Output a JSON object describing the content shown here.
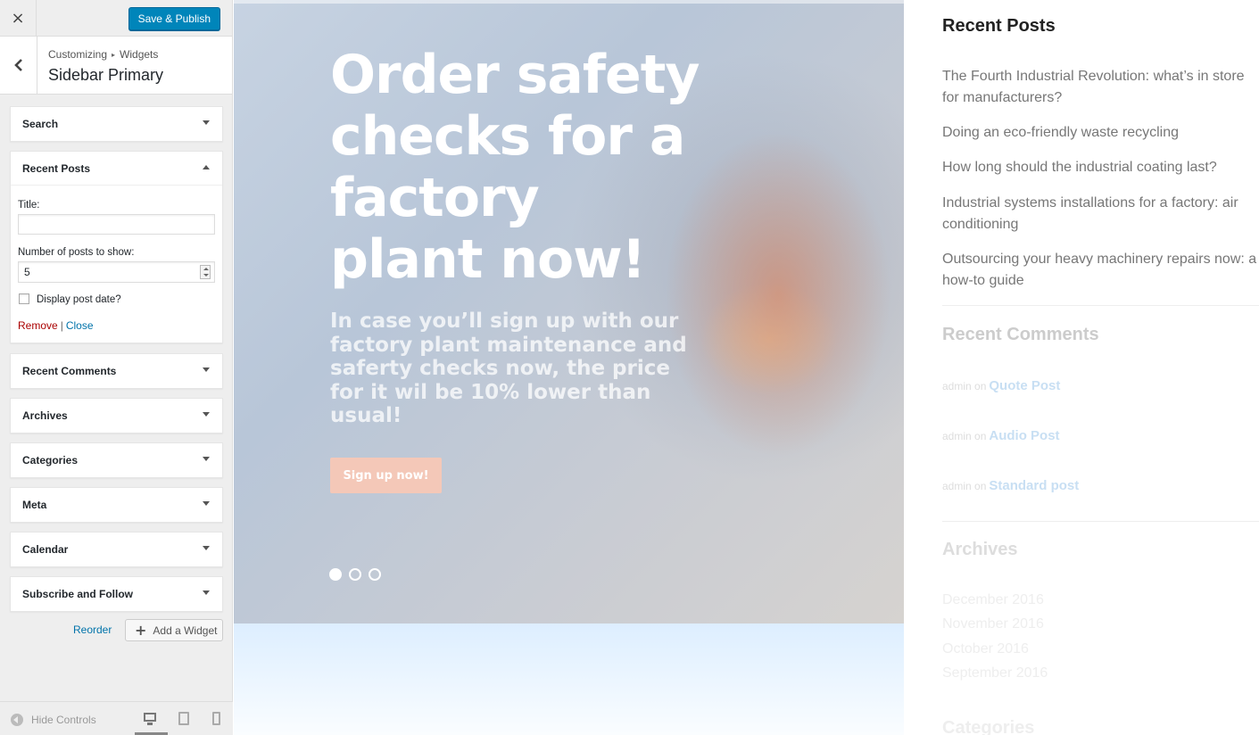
{
  "header": {
    "close_icon": "×",
    "save_label": "Save & Publish"
  },
  "panel": {
    "breadcrumb_root": "Customizing",
    "breadcrumb_sep": "▸",
    "breadcrumb_section": "Widgets",
    "title": "Sidebar Primary"
  },
  "widgets": [
    {
      "label": "Search",
      "expanded": false
    },
    {
      "label": "Recent Posts",
      "expanded": true
    },
    {
      "label": "Recent Comments",
      "expanded": false
    },
    {
      "label": "Archives",
      "expanded": false
    },
    {
      "label": "Categories",
      "expanded": false
    },
    {
      "label": "Meta",
      "expanded": false
    },
    {
      "label": "Calendar",
      "expanded": false
    },
    {
      "label": "Subscribe and Follow",
      "expanded": false
    }
  ],
  "recent_posts_form": {
    "title_label": "Title:",
    "title_value": "",
    "number_label": "Number of posts to show:",
    "number_value": "5",
    "show_date_label": "Display post date?",
    "show_date_checked": false,
    "remove_label": "Remove",
    "separator": "|",
    "close_label": "Close"
  },
  "widget_actions": {
    "reorder_label": "Reorder",
    "add_label": "Add a Widget",
    "add_icon": "plus-icon"
  },
  "footer": {
    "hide_controls_label": "Hide Controls",
    "devices": [
      "desktop",
      "tablet",
      "mobile"
    ],
    "active_device": "desktop"
  },
  "preview": {
    "hero": {
      "title": "Order safety checks for a factory plant now!",
      "subtitle": "In case you’ll sign up with our factory plant maintenance and saferty checks now, the price for it wil be 10% lower than usual!",
      "button_label": "Sign up now!",
      "slides": 3,
      "active_slide": 1
    },
    "sidebar": {
      "recent_posts_heading": "Recent Posts",
      "recent_posts": [
        "The Fourth Industrial Revolution: what’s in store for manufacturers?",
        "Doing an eco-friendly waste recycling",
        "How long should the industrial coating last?",
        "Industrial systems installations for a factory: air conditioning",
        "Outsourcing your heavy machinery repairs now: a how-to guide"
      ],
      "recent_comments_heading": "Recent Comments",
      "recent_comments": [
        {
          "author": "admin",
          "on": "on",
          "post": "Quote Post"
        },
        {
          "author": "admin",
          "on": "on",
          "post": "Audio Post"
        },
        {
          "author": "admin",
          "on": "on",
          "post": "Standard post"
        }
      ],
      "archives_heading": "Archives",
      "archives": [
        "December 2016",
        "November 2016",
        "October 2016",
        "September 2016"
      ],
      "categories_heading": "Categories"
    }
  },
  "colors": {
    "primary_button": "#0085ba",
    "link": "#0073aa",
    "remove_link": "#a00",
    "hero_button": "#f4c8b8"
  }
}
